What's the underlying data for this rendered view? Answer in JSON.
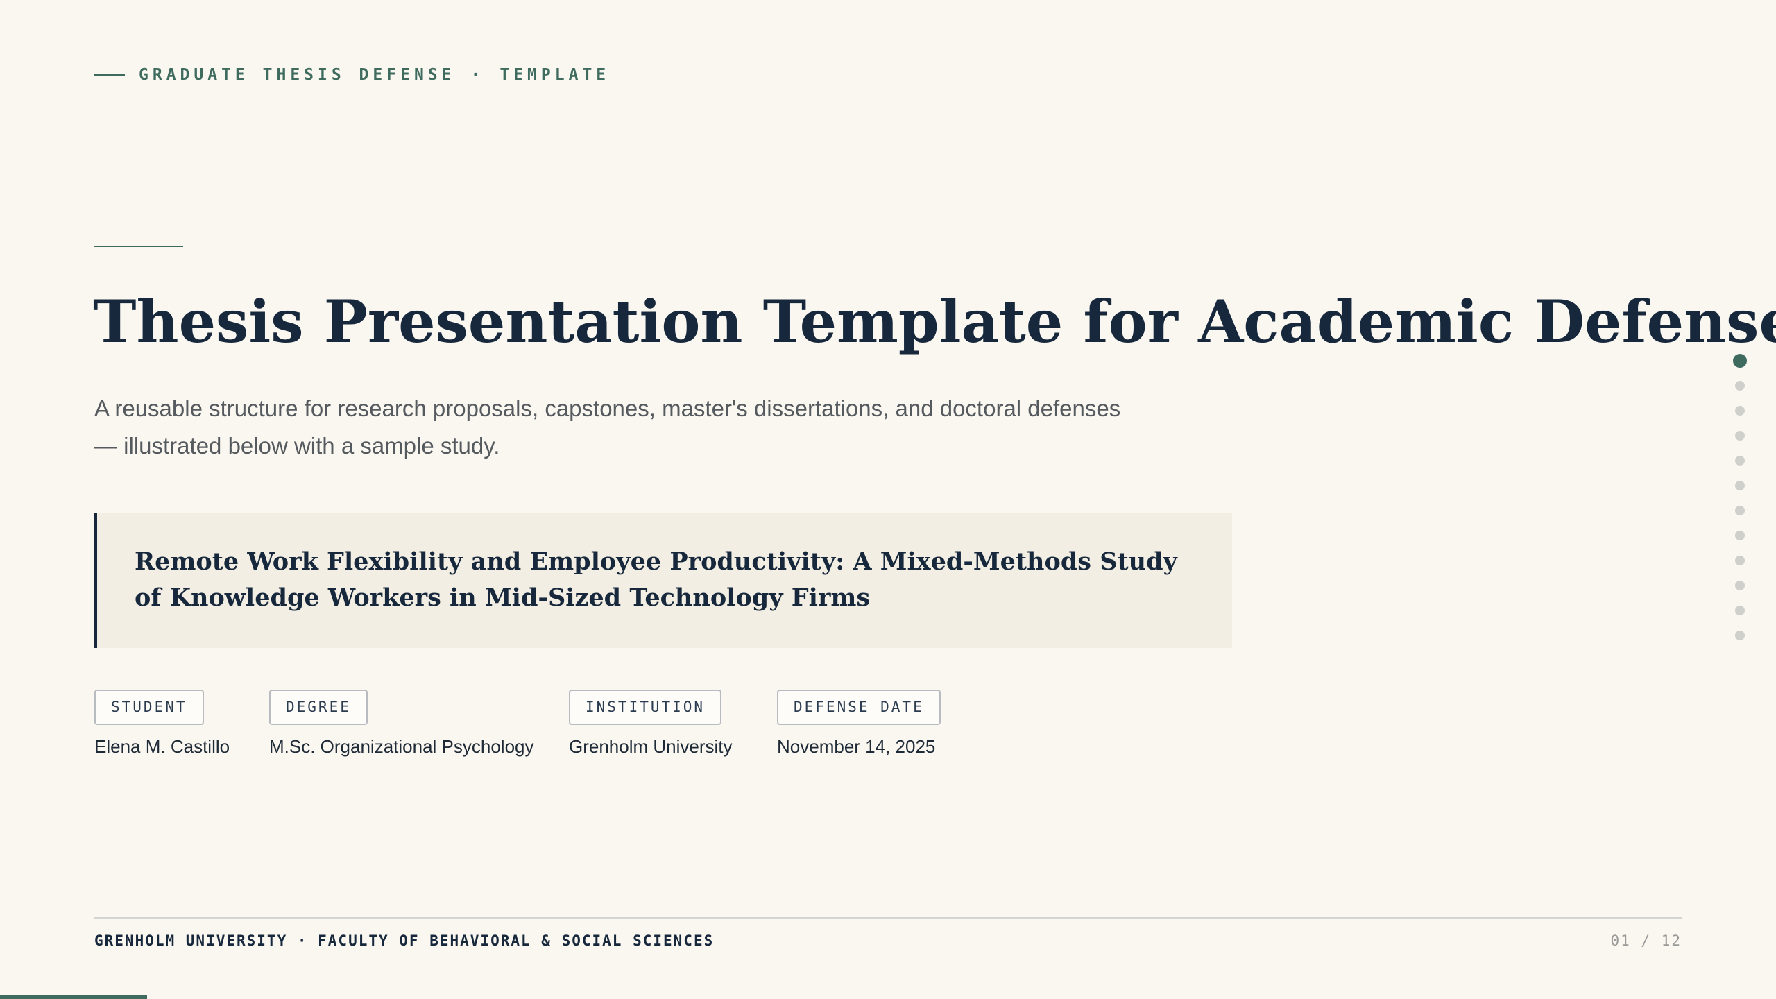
{
  "header": {
    "eyebrow_primary": "GRADUATE THESIS DEFENSE",
    "eyebrow_separator": "·",
    "eyebrow_secondary": "TEMPLATE"
  },
  "slide": {
    "title": "Thesis Presentation Template for Academic Defense",
    "subtitle": "A reusable structure for research proposals, capstones, master's dissertations, and doctoral defenses — illustrated below with a sample study.",
    "study_title": "Remote Work Flexibility and Employee Productivity: A Mixed-Methods Study of Knowledge Workers in Mid-Sized Technology Firms"
  },
  "meta": [
    {
      "label": "STUDENT",
      "value": "Elena M. Castillo"
    },
    {
      "label": "DEGREE",
      "value": "M.Sc. Organizational Psychology"
    },
    {
      "label": "INSTITUTION",
      "value": "Grenholm University"
    },
    {
      "label": "DEFENSE DATE",
      "value": "November 14, 2025"
    }
  ],
  "navigation": {
    "total_slides": 12,
    "current_slide": 1
  },
  "footer": {
    "institution": "GRENHOLM UNIVERSITY · FACULTY OF BEHAVIORAL & SOCIAL SCIENCES",
    "page_indicator": "01 / 12"
  },
  "progress": {
    "fraction": 0.083
  },
  "colors": {
    "accent": "#3f6b5f",
    "ink": "#17283c",
    "background": "#faf7f1",
    "panel": "#f2eee4"
  }
}
